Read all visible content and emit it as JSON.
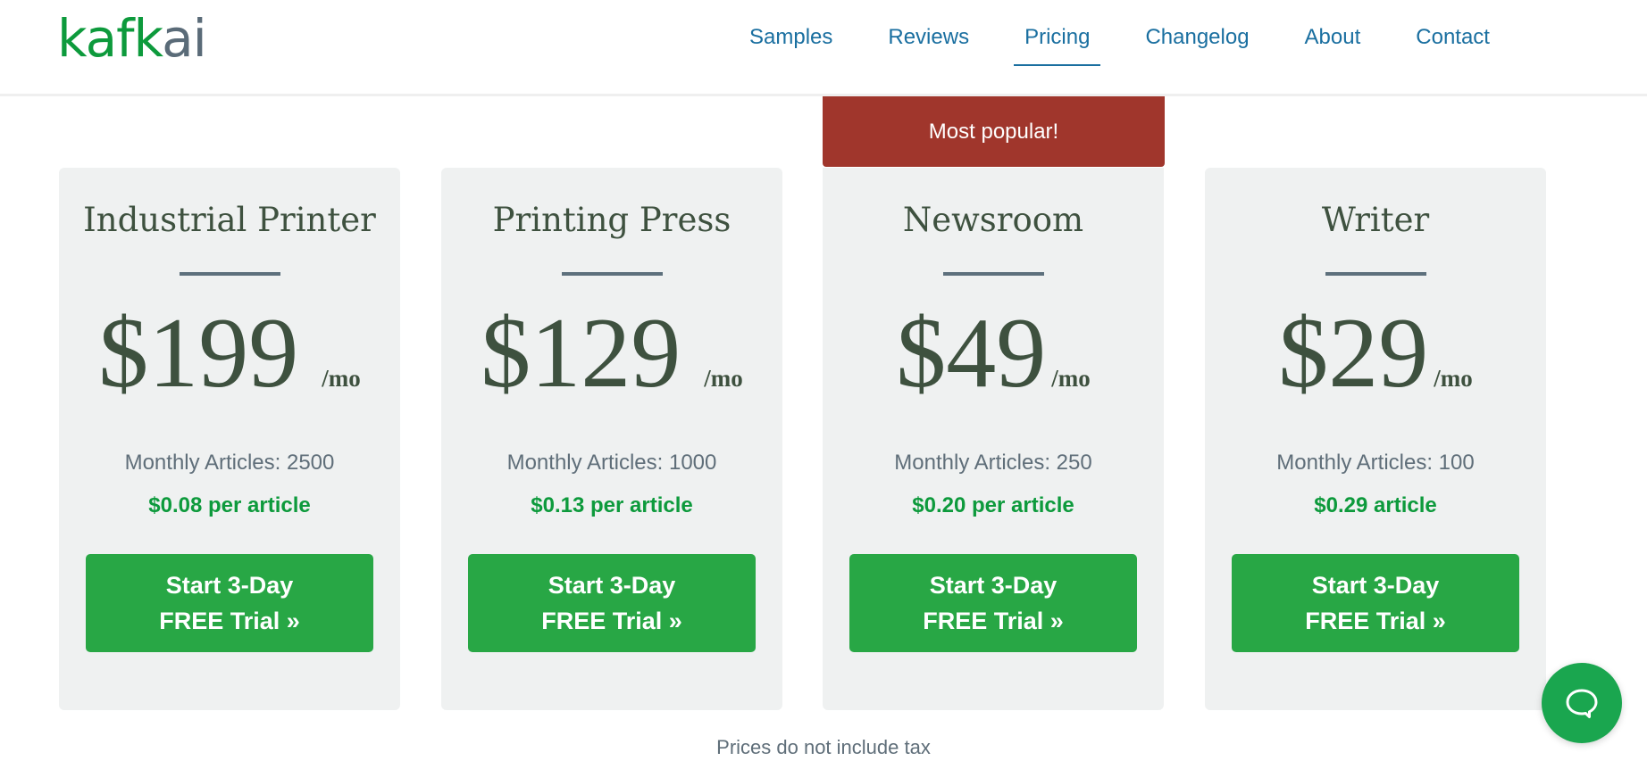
{
  "header": {
    "logo": {
      "part1": "kafk",
      "part2": "ai"
    },
    "nav": [
      {
        "label": "Samples",
        "active": false
      },
      {
        "label": "Reviews",
        "active": false
      },
      {
        "label": "Pricing",
        "active": true
      },
      {
        "label": "Changelog",
        "active": false
      },
      {
        "label": "About",
        "active": false
      },
      {
        "label": "Contact",
        "active": false
      }
    ]
  },
  "badge": {
    "label": "Most popular!"
  },
  "plans": [
    {
      "name": "Industrial Printer",
      "price": "$199",
      "period": "/mo",
      "articles": "Monthly Articles: 2500",
      "unit_price": "$0.08 per article",
      "cta": [
        "Start 3-Day",
        "FREE Trial »"
      ]
    },
    {
      "name": "Printing Press",
      "price": "$129",
      "period": "/mo",
      "articles": "Monthly Articles: 1000",
      "unit_price": "$0.13 per article",
      "cta": [
        "Start 3-Day",
        "FREE Trial »"
      ]
    },
    {
      "name": "Newsroom",
      "price": "$49",
      "period": "/mo",
      "articles": "Monthly Articles: 250",
      "unit_price": "$0.20 per article",
      "cta": [
        "Start 3-Day",
        "FREE Trial »"
      ],
      "popular": true
    },
    {
      "name": "Writer",
      "price": "$29",
      "period": "/mo",
      "articles": "Monthly Articles: 100",
      "unit_price": "$0.29 article",
      "cta": [
        "Start 3-Day",
        "FREE Trial »"
      ]
    }
  ],
  "footnote": "Prices do not include tax",
  "chat": {
    "icon": "chat-bubble-icon"
  },
  "colors": {
    "brand_green": "#0d9a3c",
    "cta_green": "#28a745",
    "badge_red": "#a0362c",
    "nav_blue": "#1a6fa0",
    "card_bg": "#eff1f1"
  }
}
